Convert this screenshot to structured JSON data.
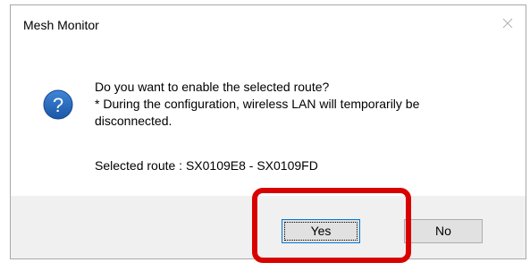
{
  "dialog": {
    "title": "Mesh Monitor",
    "icons": {
      "close": "close-icon",
      "question": "question-icon"
    },
    "message": {
      "line1": "Do you want to enable the selected route?",
      "line2": "* During the configuration, wireless LAN will temporarily be",
      "line3": "disconnected."
    },
    "selected_route": "Selected route : SX0109E8 - SX0109FD",
    "buttons": {
      "yes_label": "Yes",
      "no_label": "No"
    }
  },
  "colors": {
    "question_icon_fill": "#1e5faf",
    "highlight_border": "#d90000",
    "footer_bg": "#f0f0f0",
    "focus_border": "#0078d7"
  }
}
